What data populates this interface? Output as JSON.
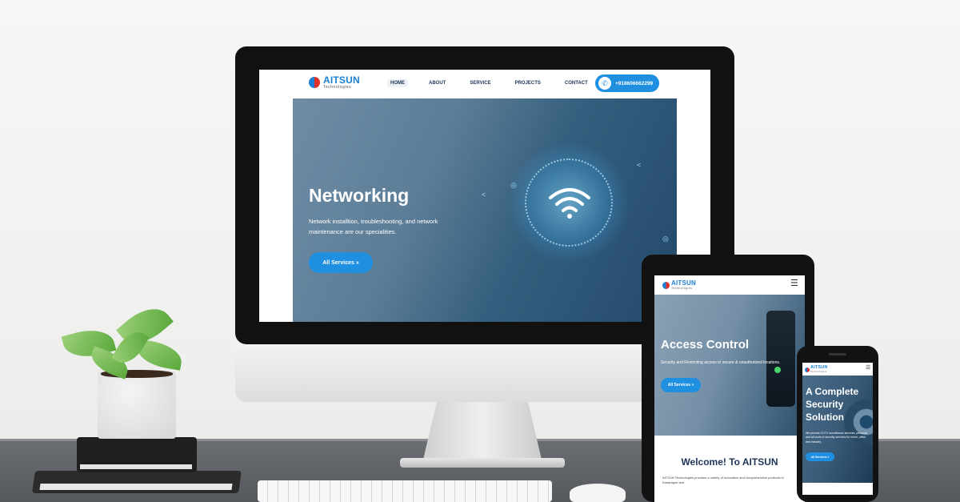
{
  "desktop_site": {
    "brand": {
      "name": "AITSUN",
      "subtitle": "Technologies"
    },
    "nav": [
      {
        "label": "HOME",
        "active": true
      },
      {
        "label": "ABOUT",
        "active": false
      },
      {
        "label": "SERVICE",
        "active": false
      },
      {
        "label": "PROJECTS",
        "active": false
      },
      {
        "label": "CONTACT",
        "active": false
      }
    ],
    "phone": "+918606662299",
    "hero": {
      "title": "Networking",
      "description": "Network installtion, troubleshooting, and network maintenance are our specialities.",
      "button": "All Services  »"
    }
  },
  "tablet_site": {
    "brand": {
      "name": "AITSUN",
      "subtitle": "Technologies"
    },
    "menu_icon": "hamburger-menu-icon",
    "hero": {
      "title": "Access Control",
      "description": "Security and Restricting access to secure & unauthorized locations.",
      "button": "All Services  »"
    },
    "welcome_title": "Welcome! To AITSUN",
    "welcome_text": "AITSUN Technologies provides a variety of innovative and comprehensive products in Kasaragod and"
  },
  "phone_site": {
    "brand": {
      "name": "AITSUN",
      "subtitle": "Technologies"
    },
    "menu_icon": "hamburger-menu-icon",
    "hero": {
      "title": "A Complete Security Solution",
      "description": "We provide CCTV surveillance services, personal and all kinds of security services for home, office, and industry.",
      "button": "All Services  »"
    }
  },
  "colors": {
    "brand_blue": "#1f8fe0",
    "brand_red": "#e0302c",
    "nav_text": "#1d3557"
  }
}
